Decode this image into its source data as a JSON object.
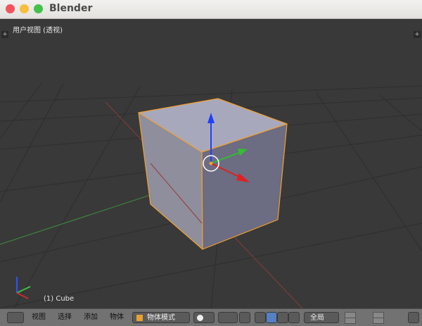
{
  "window": {
    "title": "Blender"
  },
  "viewport": {
    "label": "用户视图 (透视)",
    "object_label": "(1) Cube"
  },
  "toolbar": {
    "menus": [
      "视图",
      "选择",
      "添加",
      "物体"
    ],
    "mode": "物体模式",
    "orientation": "全局"
  },
  "colors": {
    "close": "#f2545b",
    "minimize": "#f9be3e",
    "maximize": "#43c14b",
    "background": "#393939",
    "selection": "#f0a030",
    "cube_face": "#9c9cb0"
  }
}
